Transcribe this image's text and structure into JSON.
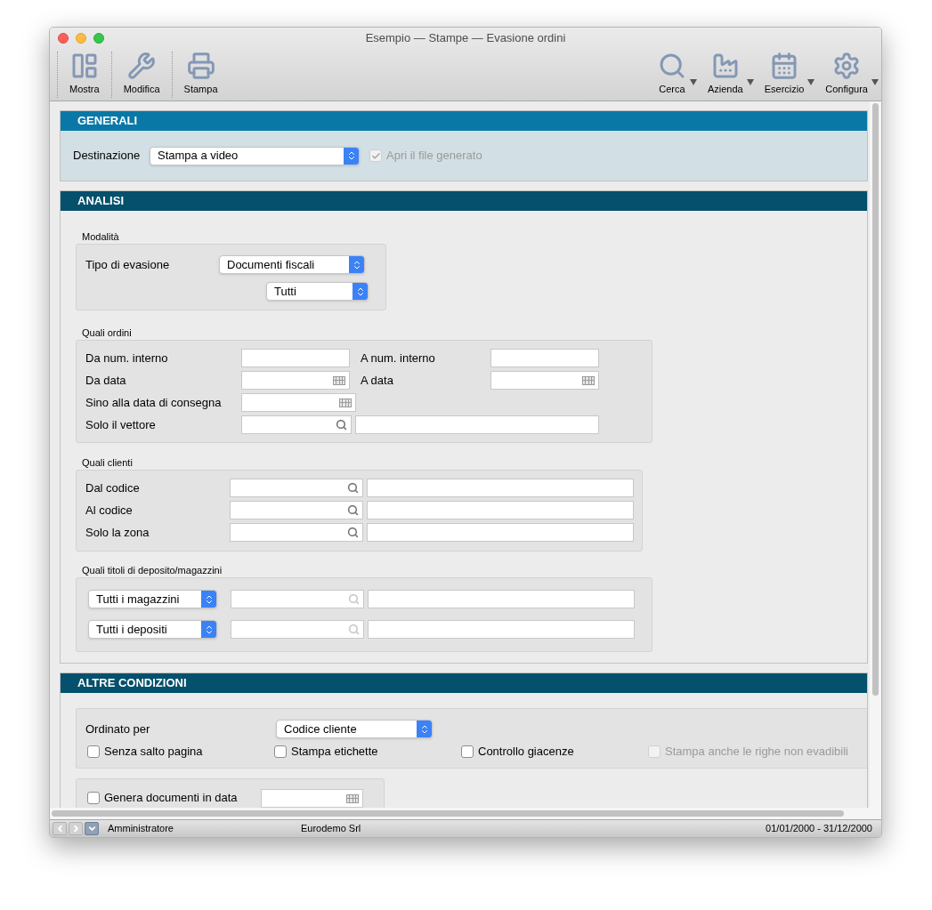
{
  "window": {
    "title": "Esempio — Stampe — Evasione ordini"
  },
  "toolbar": {
    "left": [
      {
        "label": "Mostra",
        "has_menu": false
      },
      {
        "label": "Modifica",
        "has_menu": false
      },
      {
        "label": "Stampa",
        "has_menu": false
      }
    ],
    "right": [
      {
        "label": "Cerca",
        "has_menu": true
      },
      {
        "label": "Azienda",
        "has_menu": true
      },
      {
        "label": "Esercizio",
        "has_menu": true
      },
      {
        "label": "Configura",
        "has_menu": true
      }
    ]
  },
  "generali": {
    "title": "GENERALI",
    "label": "Destinazione",
    "value": "Stampa a video",
    "checkbox": {
      "label": "Apri il file generato",
      "checked": true,
      "disabled": true
    }
  },
  "analisi": {
    "title": "ANALISI",
    "modalita": {
      "caption": "Modalità",
      "label": "Tipo di evasione",
      "value": "Documenti fiscali",
      "filter_value": "Tutti"
    },
    "quali_ordini": {
      "caption": "Quali ordini",
      "rows": [
        {
          "kind": "textrange",
          "label": "Da num. interno",
          "label2": "A num. interno"
        },
        {
          "kind": "daterange",
          "label": "Da data",
          "label2": "A data"
        },
        {
          "kind": "date",
          "label": "Sino alla data di consegna"
        },
        {
          "kind": "lookup",
          "label": "Solo il vettore"
        }
      ]
    },
    "quali_clienti": {
      "caption": "Quali clienti",
      "rows": [
        {
          "label": "Dal codice"
        },
        {
          "label": "Al codice"
        },
        {
          "label": "Solo la zona"
        }
      ]
    },
    "magazzini": {
      "caption": "Quali titoli di deposito/magazzini",
      "rows": [
        {
          "value": "Tutti i magazzini",
          "disabled": true
        },
        {
          "value": "Tutti i depositi",
          "disabled": true
        }
      ]
    }
  },
  "altre": {
    "title": "ALTRE CONDIZIONI",
    "label": "Ordinato per",
    "value": "Codice cliente",
    "checkboxes": [
      {
        "label": "Senza salto pagina",
        "checked": false,
        "disabled": false
      },
      {
        "label": "Stampa etichette",
        "checked": false,
        "disabled": false
      },
      {
        "label": "Controllo giacenze",
        "checked": false,
        "disabled": false
      },
      {
        "label": "Stampa anche le righe non evadibili",
        "checked": false,
        "disabled": true
      }
    ],
    "genera": {
      "label": "Genera documenti in data",
      "checked": false,
      "disabled": false
    }
  },
  "status": {
    "user": "Amministratore",
    "company": "Eurodemo Srl",
    "period": "01/01/2000 - 31/12/2000"
  }
}
